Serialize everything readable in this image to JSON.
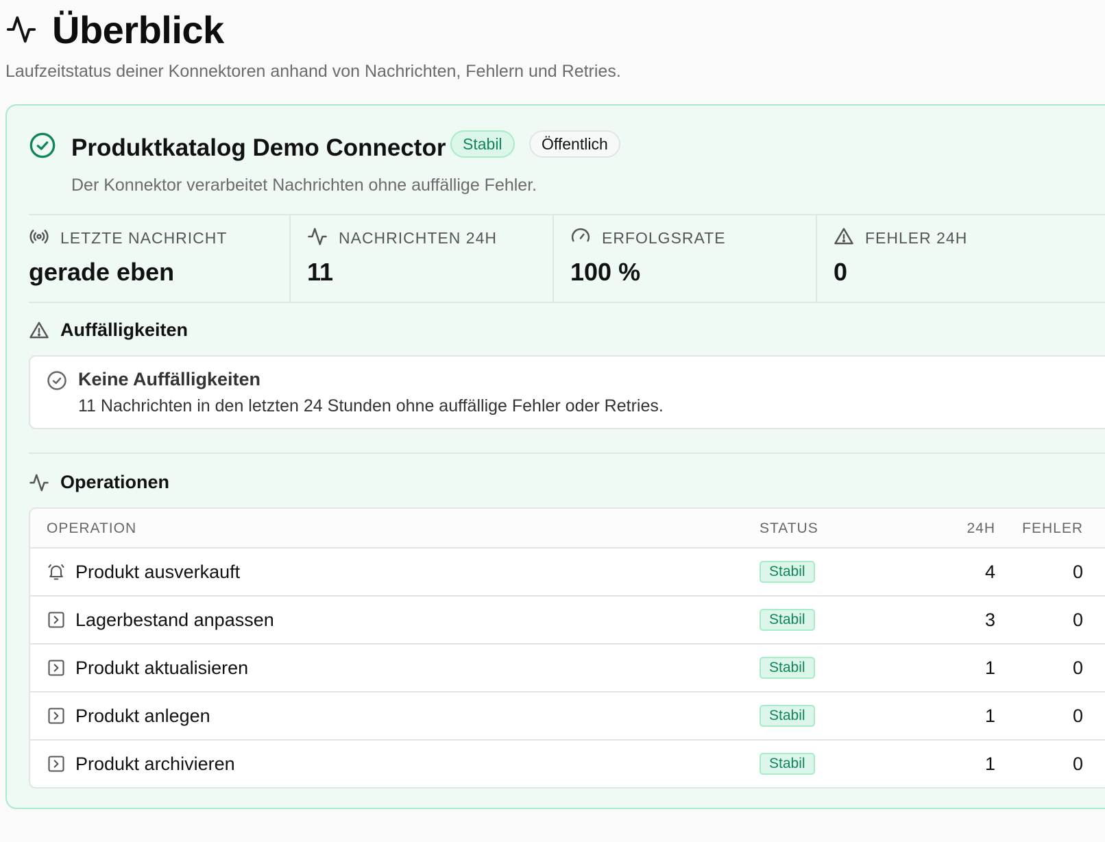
{
  "header": {
    "title": "Überblick",
    "subtitle": "Laufzeitstatus deiner Konnektoren anhand von Nachrichten, Fehlern und Retries.",
    "icon": "activity-icon"
  },
  "connector": {
    "name": "Produktkatalog Demo Connector",
    "status_badge": "Stabil",
    "visibility_badge": "Öffentlich",
    "description": "Der Konnektor verarbeitet Nachrichten ohne auffällige Fehler.",
    "icon": "check-circle-icon",
    "accent_color": "#10845a"
  },
  "metrics": [
    {
      "label": "Letzte Nachricht",
      "value": "gerade eben",
      "icon": "broadcast-icon"
    },
    {
      "label": "Nachrichten 24h",
      "value": "11",
      "icon": "activity-icon"
    },
    {
      "label": "Erfolgsrate",
      "value": "100 %",
      "icon": "gauge-icon"
    },
    {
      "label": "Fehler 24h",
      "value": "0",
      "icon": "warning-icon"
    }
  ],
  "anomalies": {
    "title": "Auffälligkeiten",
    "notice_title": "Keine Auffälligkeiten",
    "notice_text": "11 Nachrichten in den letzten 24 Stunden ohne auffällige Fehler oder Retries."
  },
  "operations": {
    "title": "Operationen",
    "columns": {
      "operation": "OPERATION",
      "status": "STATUS",
      "h24": "24H",
      "errors": "FEHLER"
    },
    "rows": [
      {
        "name": "Produkt ausverkauft",
        "status": "Stabil",
        "h24": "4",
        "errors": "0",
        "icon": "bell-icon"
      },
      {
        "name": "Lagerbestand anpassen",
        "status": "Stabil",
        "h24": "3",
        "errors": "0",
        "icon": "action-icon"
      },
      {
        "name": "Produkt aktualisieren",
        "status": "Stabil",
        "h24": "1",
        "errors": "0",
        "icon": "action-icon"
      },
      {
        "name": "Produkt anlegen",
        "status": "Stabil",
        "h24": "1",
        "errors": "0",
        "icon": "action-icon"
      },
      {
        "name": "Produkt archivieren",
        "status": "Stabil",
        "h24": "1",
        "errors": "0",
        "icon": "action-icon"
      }
    ]
  }
}
